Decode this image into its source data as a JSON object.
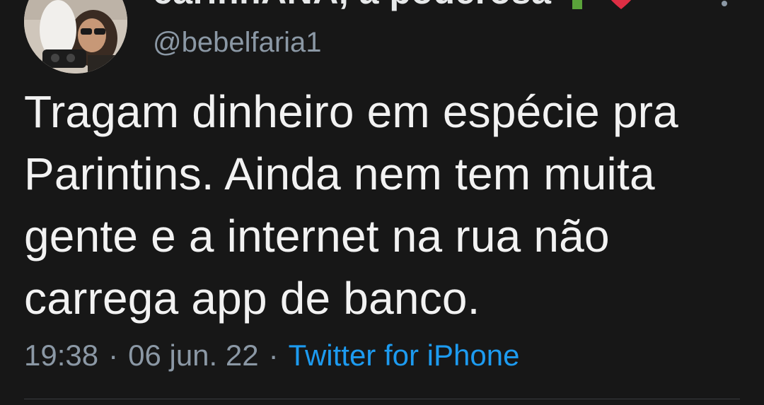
{
  "tweet": {
    "author": {
      "display_name": "carinhANA, a poderosa",
      "handle": "@bebelfaria1",
      "emojis": [
        "cactus-emoji",
        "heart-emoji"
      ]
    },
    "text_lines": [
      "Tragam dinheiro em espécie pra",
      "Parintins. Ainda nem tem muita",
      "gente e a internet na rua não",
      "carrega app de banco."
    ],
    "time": "19:38",
    "separator": "·",
    "date": "06 jun. 22",
    "source": "Twitter for iPhone"
  },
  "colors": {
    "background": "#171717",
    "text": "#f2f2f2",
    "secondary": "#8b98a5",
    "link": "#1d9bf0"
  },
  "icons": [
    "more-options-icon"
  ]
}
